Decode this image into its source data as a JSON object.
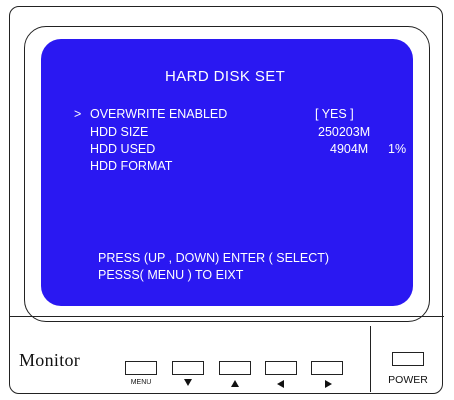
{
  "osd": {
    "title": "HARD DISK SET",
    "cursor": ">",
    "rows": [
      {
        "label": "OVERWRITE ENABLED",
        "value": "[ YES ]",
        "extra": ""
      },
      {
        "label": "HDD  SIZE",
        "value": "250203M",
        "extra": ""
      },
      {
        "label": "HDD  USED",
        "value": "4904M",
        "extra": "1%"
      },
      {
        "label": "HDD  FORMAT",
        "value": "",
        "extra": ""
      }
    ],
    "help_line_1": "PRESS (UP , DOWN)  ENTER ( SELECT)",
    "help_line_2": "PESSS( MENU )   TO  EIXT",
    "screen_color": "#2a18f2",
    "text_color": "#ffffff"
  },
  "panel": {
    "brand": "Monitor",
    "buttons": [
      {
        "name": "menu",
        "label": "MENU"
      },
      {
        "name": "down",
        "icon": "triangle-down-icon"
      },
      {
        "name": "up",
        "icon": "triangle-up-icon"
      },
      {
        "name": "left",
        "icon": "triangle-left-icon"
      },
      {
        "name": "right",
        "icon": "triangle-right-icon"
      }
    ],
    "power_label": "POWER"
  }
}
